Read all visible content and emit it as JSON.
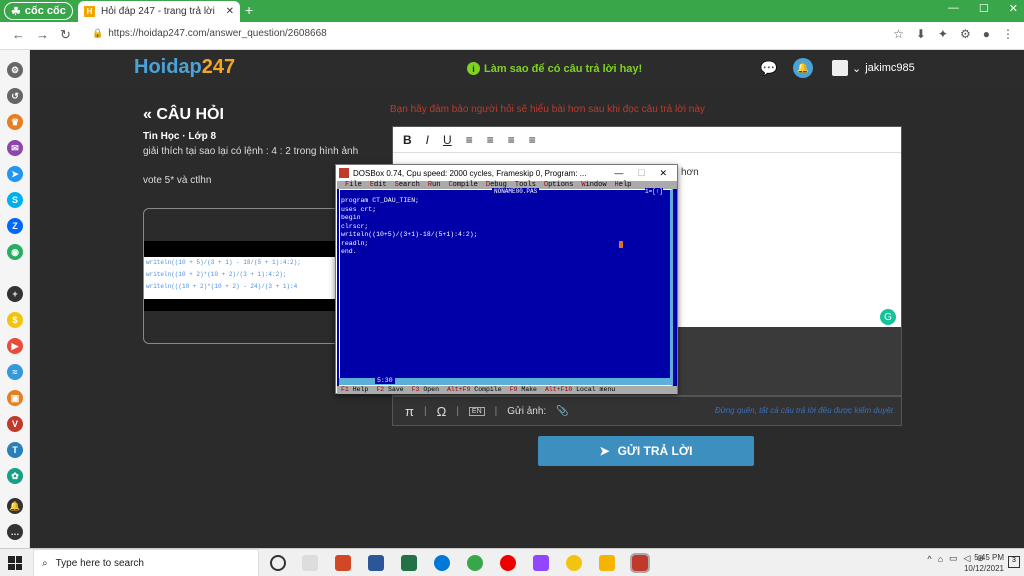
{
  "browser": {
    "brand": "cốc cốc",
    "tab_title": "Hỏi đáp 247 - trang trả lời",
    "url": "https://hoidap247.com/answer_question/2608668"
  },
  "site": {
    "logo_main": "Hoidap",
    "logo_num": "247",
    "hint": "Làm sao để có câu trả lời hay!",
    "username": "jakimc985"
  },
  "question": {
    "heading": "« CÂU HỎI",
    "subject": "Tin Học · Lớp 8",
    "text": "giải thích tại sao lại có lệnh : 4 : 2 trong hình ảnh",
    "vote": "vote 5* và ctlhn",
    "image_lines": [
      "writeln((10 + 5)/(3 + 1) - 18/(5 + 1):4:2);",
      "writeln((10 + 2)*(10 + 2)/(3 + 1):4:2);",
      "writeln(((10 + 2)*(10 + 2) - 24)/(3 + 1):4"
    ]
  },
  "editor": {
    "warning": "Bạn hãy đảm bảo người hỏi sẽ hiểu bài hơn sau khi đọc câu trả lời này",
    "toolbar": [
      "B",
      "I",
      "U",
      "≡",
      "≡",
      "≡",
      "≡"
    ],
    "partial_text": "hơn",
    "bottom": {
      "pi": "π",
      "omega": "Ω",
      "en": "EN",
      "send_image": "Gửi ảnh:",
      "note": "Đừng quên, tất cả câu trả lời đều được kiểm duyệt"
    },
    "submit": "GỬI TRẢ LỜI"
  },
  "dosbox": {
    "title": "DOSBox 0.74, Cpu speed:    2000 cycles, Frameskip  0, Program: ...",
    "menu": [
      "File",
      "Edit",
      "Search",
      "Run",
      "Compile",
      "Debug",
      "Tools",
      "Options",
      "Window",
      "Help"
    ],
    "filename": "NONAME00.PAS",
    "pos": "1=[↑]",
    "code": "program CT_DAU_TIEN;\nuses crt;\nbegin\nclrscr;\nwriteln((10+5)/(3+1)-18/(5+1):4:2);\nreadln;\nend.",
    "line_col": "5:30",
    "status": [
      {
        "key": "F1",
        "label": "Help"
      },
      {
        "key": "F2",
        "label": "Save"
      },
      {
        "key": "F3",
        "label": "Open"
      },
      {
        "key": "Alt+F9",
        "label": "Compile"
      },
      {
        "key": "F9",
        "label": "Make"
      },
      {
        "key": "Alt+F10",
        "label": "Local menu"
      }
    ]
  },
  "taskbar": {
    "search_placeholder": "Type here to search",
    "time": "5:45 PM",
    "date": "10/12/2021"
  }
}
